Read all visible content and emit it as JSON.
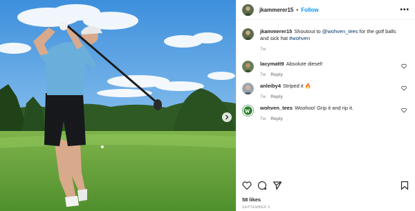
{
  "post": {
    "author": "jkammerer15",
    "separator": "•",
    "follow_label": "Follow",
    "more_label": "•••"
  },
  "caption": {
    "username": "jkammerer15",
    "text_before": "Shoutout to ",
    "mention": "@wohven_tees",
    "text_after": " for the golf balls and sick hat ",
    "hashtag": "#wohven",
    "time": "7w"
  },
  "comments": [
    {
      "username": "lacymatt9",
      "text": "Absolute diesel!",
      "time": "7w",
      "reply": "Reply"
    },
    {
      "username": "anleiby4",
      "text": "Striped it 🔥",
      "time": "7w",
      "reply": "Reply"
    },
    {
      "username": "wohven_tees",
      "text": "Woohoo! Grip it and rip it.",
      "time": "7w",
      "reply": "Reply"
    }
  ],
  "likes": "58 likes",
  "date": "SEPTEMBER 5",
  "icons": {
    "like": "heart-icon",
    "comment": "comment-icon",
    "share": "send-icon",
    "save": "bookmark-icon",
    "next": "chevron-right-icon"
  },
  "colors": {
    "link": "#00376b",
    "follow": "#0095f6",
    "muted": "#8e8e8e"
  }
}
